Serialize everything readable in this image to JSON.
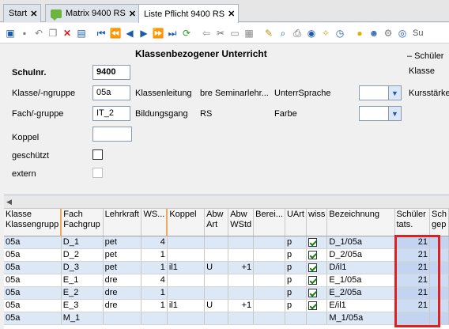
{
  "tabs": [
    {
      "label": "Start",
      "close": "✕"
    },
    {
      "label": "Matrix 9400 RS",
      "close": "✕"
    },
    {
      "label": "Liste Pflicht 9400 RS",
      "close": "✕"
    }
  ],
  "toolbar": {
    "icons": [
      "new-icon",
      "save-icon",
      "undo-icon",
      "copy-icon",
      "delete-icon",
      "card-icon",
      "first-icon",
      "prev-page-icon",
      "prev-icon",
      "next-icon",
      "next-page-icon",
      "last-icon",
      "refresh-icon",
      "arrow-left-icon",
      "cut-icon",
      "paste-icon",
      "copy2-icon",
      "edit-icon",
      "find-icon",
      "print-icon",
      "view-icon",
      "broom-icon",
      "clock-icon",
      "bulb-icon",
      "person-icon",
      "gear-icon",
      "search-icon"
    ],
    "more_label": "Su"
  },
  "form": {
    "title": "Klassenbezogener Unterricht",
    "schulnr_label": "Schulnr.",
    "schulnr_value": "9400",
    "klasse_label": "Klasse/-ngruppe",
    "klasse_value": "05a",
    "klassenleitung_label": "Klassenleitung",
    "klassenleitung_value": "bre Seminarlehr...",
    "unterrsprache_label": "UnterrSprache",
    "fach_label": "Fach/-gruppe",
    "fach_value": "IT_2",
    "bildungsgang_label": "Bildungsgang",
    "bildungsgang_value": "RS",
    "farbe_label": "Farbe",
    "koppel_label": "Koppel",
    "geschuetzt_label": "geschützt",
    "extern_label": "extern",
    "right_schueler": "– Schüler",
    "right_klasse": "Klasse",
    "right_kursstaerke": "Kursstärke"
  },
  "grid": {
    "headers": [
      {
        "line1": "Klasse",
        "line2": "Klassengrupp"
      },
      {
        "line1": "Fach",
        "line2": "Fachgrup"
      },
      {
        "line1": "Lehrkraft",
        "line2": ""
      },
      {
        "line1": "WS...",
        "line2": ""
      },
      {
        "line1": "Koppel",
        "line2": ""
      },
      {
        "line1": "Abw",
        "line2": "Art"
      },
      {
        "line1": "Abw",
        "line2": "WStd"
      },
      {
        "line1": "Berei...",
        "line2": ""
      },
      {
        "line1": "UArt",
        "line2": ""
      },
      {
        "line1": "wiss",
        "line2": ""
      },
      {
        "line1": "Bezeichnung",
        "line2": ""
      },
      {
        "line1": "Schüler",
        "line2": "tats."
      },
      {
        "line1": "Sch",
        "line2": "gep"
      }
    ],
    "rows": [
      {
        "klasse": "05a",
        "fach": "D_1",
        "lehrkraft": "pet",
        "ws": "4",
        "koppel": "",
        "abwart": "",
        "abwwstd": "",
        "berei": "",
        "uart": "p",
        "bez": "D_1/05a",
        "schueler": "21"
      },
      {
        "klasse": "05a",
        "fach": "D_2",
        "lehrkraft": "pet",
        "ws": "1",
        "koppel": "",
        "abwart": "",
        "abwwstd": "",
        "berei": "",
        "uart": "p",
        "bez": "D_2/05a",
        "schueler": "21"
      },
      {
        "klasse": "05a",
        "fach": "D_3",
        "lehrkraft": "pet",
        "ws": "1",
        "koppel": "il1",
        "abwart": "U",
        "abwwstd": "+1",
        "berei": "",
        "uart": "p",
        "bez": "D/il1",
        "schueler": "21"
      },
      {
        "klasse": "05a",
        "fach": "E_1",
        "lehrkraft": "dre",
        "ws": "4",
        "koppel": "",
        "abwart": "",
        "abwwstd": "",
        "berei": "",
        "uart": "p",
        "bez": "E_1/05a",
        "schueler": "21"
      },
      {
        "klasse": "05a",
        "fach": "E_2",
        "lehrkraft": "dre",
        "ws": "1",
        "koppel": "",
        "abwart": "",
        "abwwstd": "",
        "berei": "",
        "uart": "p",
        "bez": "E_2/05a",
        "schueler": "21"
      },
      {
        "klasse": "05a",
        "fach": "E_3",
        "lehrkraft": "dre",
        "ws": "1",
        "koppel": "il1",
        "abwart": "U",
        "abwwstd": "+1",
        "berei": "",
        "uart": "p",
        "bez": "E/il1",
        "schueler": "21"
      },
      {
        "klasse": "05a",
        "fach": "M_1",
        "lehrkraft": "",
        "ws": "",
        "koppel": "",
        "abwart": "",
        "abwwstd": "",
        "berei": "",
        "uart": "",
        "bez": "M_1/05a",
        "schueler": ""
      }
    ]
  },
  "colors": {
    "accent": "#1f5aa8",
    "highlight": "#e02020",
    "row_alt": "#dde8f7"
  }
}
